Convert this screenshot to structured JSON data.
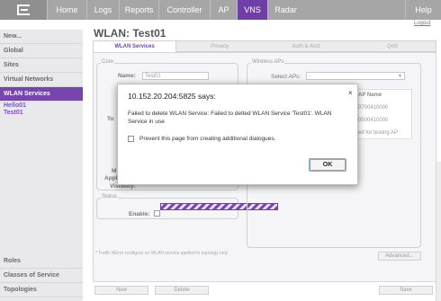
{
  "topnav": {
    "items": [
      {
        "label": "Home"
      },
      {
        "label": "Logs"
      },
      {
        "label": "Reports"
      },
      {
        "label": "Controller"
      },
      {
        "label": "AP"
      },
      {
        "label": "VNS"
      },
      {
        "label": "Radar"
      },
      {
        "label": "Help"
      }
    ],
    "active": "VNS",
    "accent_color": "#6f3ea6"
  },
  "logout": "Logout",
  "page_title": "WLAN: Test01",
  "sidebar": {
    "items": [
      {
        "label": "New..."
      },
      {
        "label": "Global"
      },
      {
        "label": "Sites"
      },
      {
        "label": "Virtual Networks"
      },
      {
        "label": "WLAN Services"
      }
    ],
    "subitems": [
      "Hello01",
      "Test01"
    ],
    "bottom_items": [
      {
        "label": "Roles"
      },
      {
        "label": "Classes of Service"
      },
      {
        "label": "Topologies"
      }
    ]
  },
  "tabs": [
    "WLAN Services",
    "Privacy",
    "Auth & Acct",
    "QoS"
  ],
  "core": {
    "legend": "Core",
    "name_label": "Name:",
    "name_value": "Test01",
    "to_label": "To",
    "m_label": "M",
    "app_label": "Appl",
    "visibility_label": "Visibility:"
  },
  "status": {
    "legend": "Status",
    "enable_label": "Enable:"
  },
  "wireless_aps": {
    "legend": "Wireless APs",
    "select_label": "Select APs:",
    "select_value": "-",
    "ap_name_header": "AP Name",
    "rows": [
      "0700410000",
      "0500410000",
      "ed for testing AP"
    ]
  },
  "footnote": "* Traffic Mirror configure on WLAN service applied to topology only",
  "buttons": {
    "advanced": "Advanced...",
    "new": "New",
    "delete": "Delete",
    "save": "Save"
  },
  "dialog": {
    "title": "10.152.20.204:5825 says:",
    "message": "Failed to delete WLAN Service: Failed to delted WLAN Service 'Test01'. WLAN Service in use",
    "checkbox_label": "Prevent this page from creating additional dialogues.",
    "ok_label": "OK",
    "close_symbol": "×"
  }
}
